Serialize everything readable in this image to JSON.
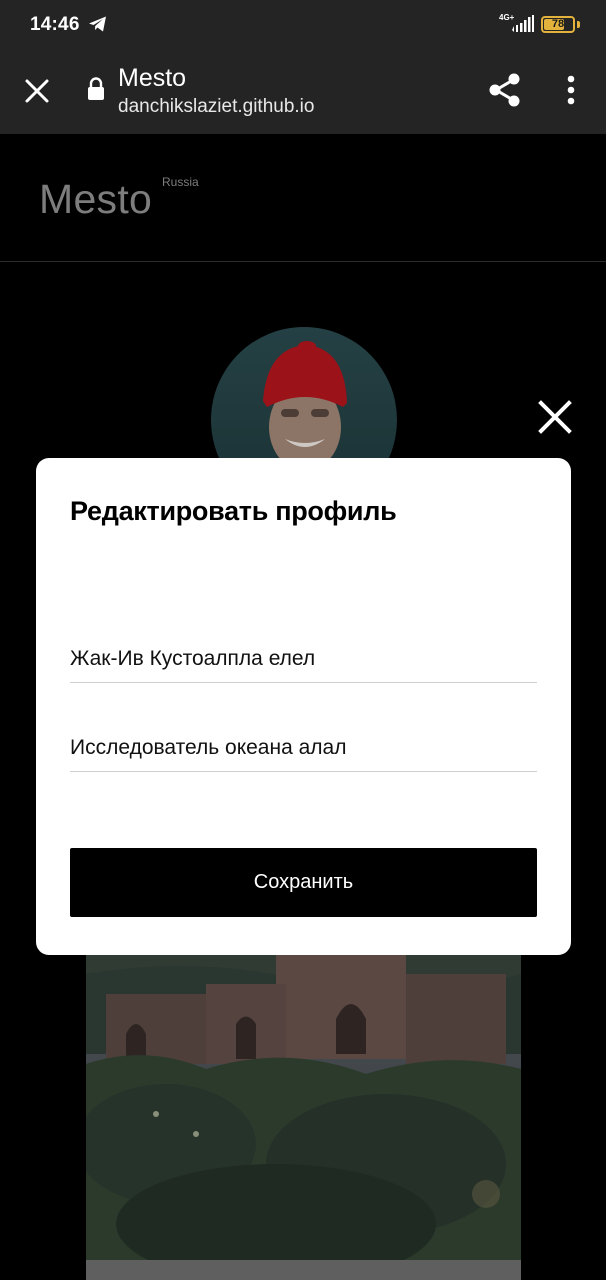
{
  "status_bar": {
    "time": "14:46",
    "network_label": "4G+",
    "battery_level": "78",
    "battery_fraction": 0.78,
    "battery_color": "#e3b23c",
    "icons": [
      "telegram-icon",
      "signal-icon",
      "battery-icon"
    ]
  },
  "browser": {
    "page_title": "Mesto",
    "url": "danchikslaziet.github.io",
    "icons": [
      "close-icon",
      "lock-icon",
      "share-icon",
      "more-vert-icon"
    ]
  },
  "header": {
    "logo_text": "Mesto",
    "logo_superscript": "Russia"
  },
  "popup": {
    "title": "Редактировать профиль",
    "name_value": "Жак-Ив Кустоалпла елел",
    "about_value": "Исследователь океана алал",
    "save_label": "Сохранить",
    "close_icon": "close-icon"
  },
  "colors": {
    "status_bar_bg": "#242424",
    "page_bg": "#000000",
    "popup_bg": "#ffffff",
    "button_bg": "#000000",
    "button_text": "#ffffff",
    "logo_dimmed": "#7d7d7d"
  }
}
